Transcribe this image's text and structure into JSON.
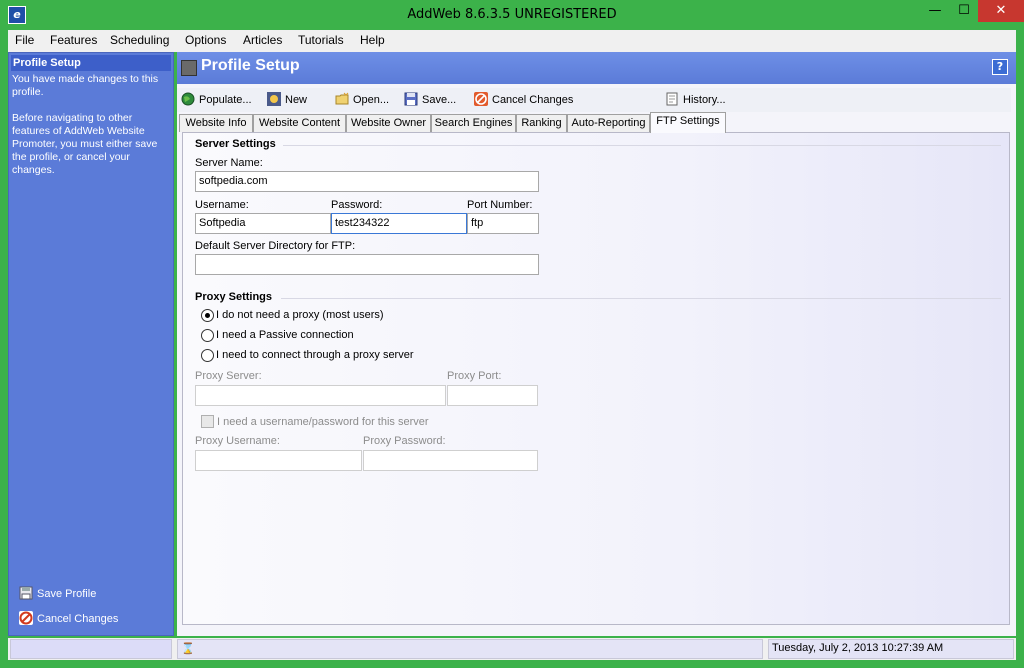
{
  "window": {
    "title": "AddWeb 8.6.3.5  UNREGISTERED",
    "minimize": "—",
    "maximize": "☐",
    "close": "✕"
  },
  "menu": [
    "File",
    "Features",
    "Scheduling",
    "Options",
    "Articles",
    "Tutorials",
    "Help"
  ],
  "sidebar": {
    "heading": "Profile Setup",
    "paragraph1": "You have made changes to this profile.",
    "paragraph2": "Before navigating to other features of AddWeb Website Promoter, you must either save the profile, or cancel your changes.",
    "save_label": "Save Profile",
    "cancel_label": "Cancel Changes"
  },
  "header": {
    "title": "Profile Setup",
    "help": "?"
  },
  "toolbar": {
    "populate": "Populate...",
    "new": "New",
    "open": "Open...",
    "save": "Save...",
    "cancel": "Cancel Changes",
    "history": "History..."
  },
  "tabs": [
    "Website Info",
    "Website Content",
    "Website Owner",
    "Search Engines",
    "Ranking",
    "Auto-Reporting",
    "FTP Settings"
  ],
  "active_tab": "FTP Settings",
  "server": {
    "heading": "Server Settings",
    "server_name_label": "Server Name:",
    "server_name": "softpedia.com",
    "username_label": "Username:",
    "username": "Softpedia",
    "password_label": "Password:",
    "password": "test234322",
    "port_label": "Port Number:",
    "port": "ftp",
    "dir_label": "Default Server Directory for FTP:",
    "dir": ""
  },
  "proxy": {
    "heading": "Proxy Settings",
    "option_none": "I do not need a proxy (most users)",
    "option_passive": "I need a Passive connection",
    "option_proxy": "I need to connect through a proxy server",
    "selected": "none",
    "server_label": "Proxy Server:",
    "port_label": "Proxy Port:",
    "auth_label": "I need a username/password for this server",
    "username_label": "Proxy Username:",
    "password_label": "Proxy Password:"
  },
  "status": {
    "datetime": "Tuesday, July 2, 2013 10:27:39 AM",
    "hourglass": "⌛"
  },
  "colors": {
    "frame": "#3cb24a",
    "sidebar": "#5b7bd8",
    "close": "#c7372f"
  }
}
